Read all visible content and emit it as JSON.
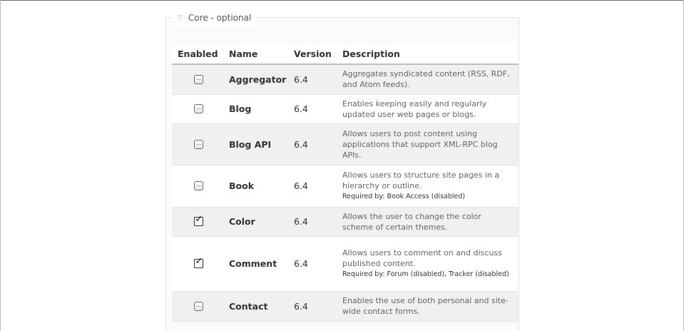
{
  "fieldset": {
    "legend": "Core - optional"
  },
  "table": {
    "headers": {
      "enabled": "Enabled",
      "name": "Name",
      "version": "Version",
      "description": "Description"
    },
    "rows": [
      {
        "checked": false,
        "name": "Aggregator",
        "version": "6.4",
        "description": "Aggregates syndicated content (RSS, RDF, and Atom feeds).",
        "required": ""
      },
      {
        "checked": false,
        "name": "Blog",
        "version": "6.4",
        "description": "Enables keeping easily and regularly updated user web pages or blogs.",
        "required": ""
      },
      {
        "checked": false,
        "name": "Blog API",
        "version": "6.4",
        "description": "Allows users to post content using applications that support XML-RPC blog APIs.",
        "required": ""
      },
      {
        "checked": false,
        "name": "Book",
        "version": "6.4",
        "description": "Allows users to structure site pages in a hierarchy or outline.",
        "required": "Required by: Book Access (disabled)"
      },
      {
        "checked": true,
        "name": "Color",
        "version": "6.4",
        "description": "Allows the user to change the color scheme of certain themes.",
        "required": ""
      },
      {
        "checked": true,
        "name": "Comment",
        "version": "6.4",
        "description": "Allows users to comment on and discuss published content.",
        "required": "Required by: Forum (disabled), Tracker (disabled)"
      },
      {
        "checked": false,
        "name": "Contact",
        "version": "6.4",
        "description": "Enables the use of both personal and site-wide contact forms.",
        "required": ""
      }
    ]
  }
}
